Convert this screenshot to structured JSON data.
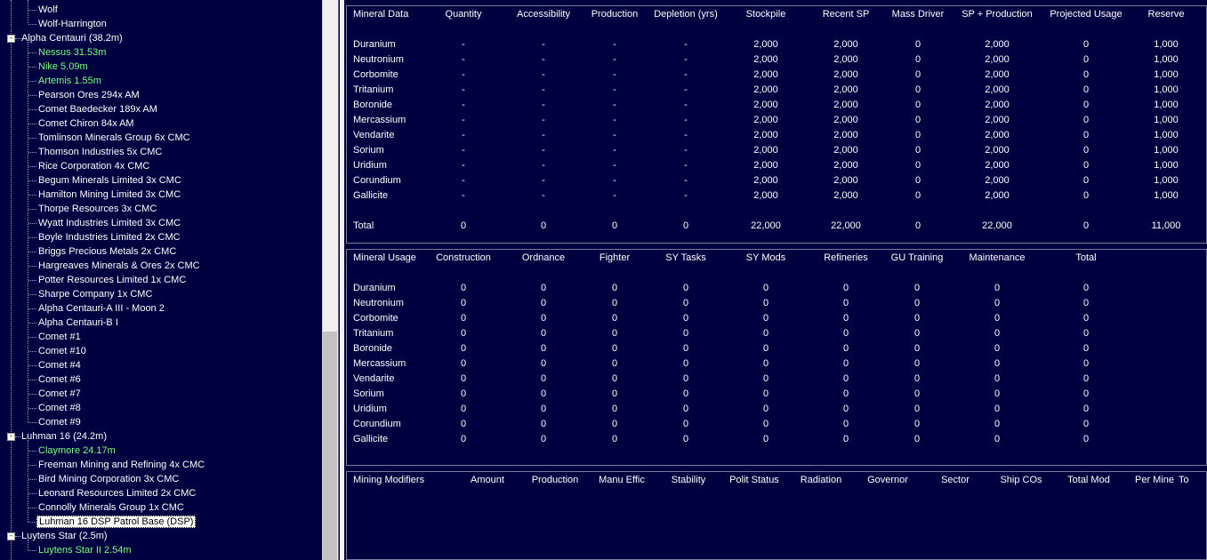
{
  "tree": {
    "nodes": [
      {
        "label": "Wolf",
        "level": 2,
        "green": false
      },
      {
        "label": "Wolf-Harrington",
        "level": 2,
        "green": false
      },
      {
        "label": "Alpha Centauri  (38.2m)",
        "level": 1,
        "expander": "-"
      },
      {
        "label": "Nessus  31.53m",
        "level": 2,
        "green": true
      },
      {
        "label": "Nike  5.09m",
        "level": 2,
        "green": true
      },
      {
        "label": "Artemis  1.55m",
        "level": 2,
        "green": true
      },
      {
        "label": "Pearson Ores  294x AM",
        "level": 2,
        "green": false
      },
      {
        "label": "Comet Baedecker  189x AM",
        "level": 2,
        "green": false
      },
      {
        "label": "Comet Chiron  84x AM",
        "level": 2,
        "green": false
      },
      {
        "label": "Tomlinson Minerals Group  6x CMC",
        "level": 2,
        "green": false
      },
      {
        "label": "Thomson Industries  5x CMC",
        "level": 2,
        "green": false
      },
      {
        "label": "Rice Corporation  4x CMC",
        "level": 2,
        "green": false
      },
      {
        "label": "Begum Minerals Limited  3x CMC",
        "level": 2,
        "green": false
      },
      {
        "label": "Hamilton Mining Limited  3x CMC",
        "level": 2,
        "green": false
      },
      {
        "label": "Thorpe Resources  3x CMC",
        "level": 2,
        "green": false
      },
      {
        "label": "Wyatt Industries Limited  3x CMC",
        "level": 2,
        "green": false
      },
      {
        "label": "Boyle Industries Limited  2x CMC",
        "level": 2,
        "green": false
      },
      {
        "label": "Briggs Precious Metals  2x CMC",
        "level": 2,
        "green": false
      },
      {
        "label": "Hargreaves Minerals & Ores  2x CMC",
        "level": 2,
        "green": false
      },
      {
        "label": "Potter Resources Limited  1x CMC",
        "level": 2,
        "green": false
      },
      {
        "label": "Sharpe Company  1x CMC",
        "level": 2,
        "green": false
      },
      {
        "label": "Alpha Centauri-A III - Moon 2",
        "level": 2,
        "green": false
      },
      {
        "label": "Alpha Centauri-B I",
        "level": 2,
        "green": false
      },
      {
        "label": "Comet #1",
        "level": 2,
        "green": false
      },
      {
        "label": "Comet #10",
        "level": 2,
        "green": false
      },
      {
        "label": "Comet #4",
        "level": 2,
        "green": false
      },
      {
        "label": "Comet #6",
        "level": 2,
        "green": false
      },
      {
        "label": "Comet #7",
        "level": 2,
        "green": false
      },
      {
        "label": "Comet #8",
        "level": 2,
        "green": false
      },
      {
        "label": "Comet #9",
        "level": 2,
        "green": false
      },
      {
        "label": "Luhman 16  (24.2m)",
        "level": 1,
        "expander": "-"
      },
      {
        "label": "Claymore  24.17m",
        "level": 2,
        "green": true
      },
      {
        "label": "Freeman Mining and Refining  4x CMC",
        "level": 2,
        "green": false
      },
      {
        "label": "Bird Mining Corporation  3x CMC",
        "level": 2,
        "green": false
      },
      {
        "label": "Leonard Resources Limited  2x CMC",
        "level": 2,
        "green": false
      },
      {
        "label": "Connolly Minerals Group  1x CMC",
        "level": 2,
        "green": false
      },
      {
        "label": "Luhman 16 DSP Patrol Base (DSP)",
        "level": 2,
        "green": false,
        "selected": true
      },
      {
        "label": "Luytens Star  (2.5m)",
        "level": 1,
        "expander": "-"
      },
      {
        "label": "Luytens Star II  2.54m",
        "level": 2,
        "green": true
      }
    ]
  },
  "mineral_data": {
    "headers": [
      "Mineral Data",
      "Quantity",
      "Accessibility",
      "Production",
      "Depletion (yrs)",
      "Stockpile",
      "Recent SP",
      "Mass Driver",
      "SP + Production",
      "Projected Usage",
      "Reserve"
    ],
    "rows": [
      [
        "Duranium",
        "-",
        "-",
        "-",
        "-",
        "2,000",
        "2,000",
        "0",
        "2,000",
        "0",
        "1,000"
      ],
      [
        "Neutronium",
        "-",
        "-",
        "-",
        "-",
        "2,000",
        "2,000",
        "0",
        "2,000",
        "0",
        "1,000"
      ],
      [
        "Corbomite",
        "-",
        "-",
        "-",
        "-",
        "2,000",
        "2,000",
        "0",
        "2,000",
        "0",
        "1,000"
      ],
      [
        "Tritanium",
        "-",
        "-",
        "-",
        "-",
        "2,000",
        "2,000",
        "0",
        "2,000",
        "0",
        "1,000"
      ],
      [
        "Boronide",
        "-",
        "-",
        "-",
        "-",
        "2,000",
        "2,000",
        "0",
        "2,000",
        "0",
        "1,000"
      ],
      [
        "Mercassium",
        "-",
        "-",
        "-",
        "-",
        "2,000",
        "2,000",
        "0",
        "2,000",
        "0",
        "1,000"
      ],
      [
        "Vendarite",
        "-",
        "-",
        "-",
        "-",
        "2,000",
        "2,000",
        "0",
        "2,000",
        "0",
        "1,000"
      ],
      [
        "Sorium",
        "-",
        "-",
        "-",
        "-",
        "2,000",
        "2,000",
        "0",
        "2,000",
        "0",
        "1,000"
      ],
      [
        "Uridium",
        "-",
        "-",
        "-",
        "-",
        "2,000",
        "2,000",
        "0",
        "2,000",
        "0",
        "1,000"
      ],
      [
        "Corundium",
        "-",
        "-",
        "-",
        "-",
        "2,000",
        "2,000",
        "0",
        "2,000",
        "0",
        "1,000"
      ],
      [
        "Gallicite",
        "-",
        "-",
        "-",
        "-",
        "2,000",
        "2,000",
        "0",
        "2,000",
        "0",
        "1,000"
      ]
    ],
    "total": [
      "Total",
      "0",
      "0",
      "0",
      "0",
      "22,000",
      "22,000",
      "0",
      "22,000",
      "0",
      "11,000"
    ]
  },
  "mineral_usage": {
    "headers": [
      "Mineral Usage",
      "Construction",
      "Ordnance",
      "Fighter",
      "SY Tasks",
      "SY Mods",
      "Refineries",
      "GU Training",
      "Maintenance",
      "Total"
    ],
    "rows": [
      [
        "Duranium",
        "0",
        "0",
        "0",
        "0",
        "0",
        "0",
        "0",
        "0",
        "0"
      ],
      [
        "Neutronium",
        "0",
        "0",
        "0",
        "0",
        "0",
        "0",
        "0",
        "0",
        "0"
      ],
      [
        "Corbomite",
        "0",
        "0",
        "0",
        "0",
        "0",
        "0",
        "0",
        "0",
        "0"
      ],
      [
        "Tritanium",
        "0",
        "0",
        "0",
        "0",
        "0",
        "0",
        "0",
        "0",
        "0"
      ],
      [
        "Boronide",
        "0",
        "0",
        "0",
        "0",
        "0",
        "0",
        "0",
        "0",
        "0"
      ],
      [
        "Mercassium",
        "0",
        "0",
        "0",
        "0",
        "0",
        "0",
        "0",
        "0",
        "0"
      ],
      [
        "Vendarite",
        "0",
        "0",
        "0",
        "0",
        "0",
        "0",
        "0",
        "0",
        "0"
      ],
      [
        "Sorium",
        "0",
        "0",
        "0",
        "0",
        "0",
        "0",
        "0",
        "0",
        "0"
      ],
      [
        "Uridium",
        "0",
        "0",
        "0",
        "0",
        "0",
        "0",
        "0",
        "0",
        "0"
      ],
      [
        "Corundium",
        "0",
        "0",
        "0",
        "0",
        "0",
        "0",
        "0",
        "0",
        "0"
      ],
      [
        "Gallicite",
        "0",
        "0",
        "0",
        "0",
        "0",
        "0",
        "0",
        "0",
        "0"
      ]
    ]
  },
  "mining_modifiers": {
    "headers": [
      "Mining Modifiers",
      "Amount",
      "Production",
      "Manu Effic",
      "Stability",
      "Polit Status",
      "Radiation",
      "Governor",
      "Sector",
      "Ship COs",
      "Total Mod",
      "Per Mine",
      "To"
    ]
  },
  "colors": {
    "background": "#000040",
    "green_text": "#7dff7d",
    "text": "#ffffff"
  }
}
